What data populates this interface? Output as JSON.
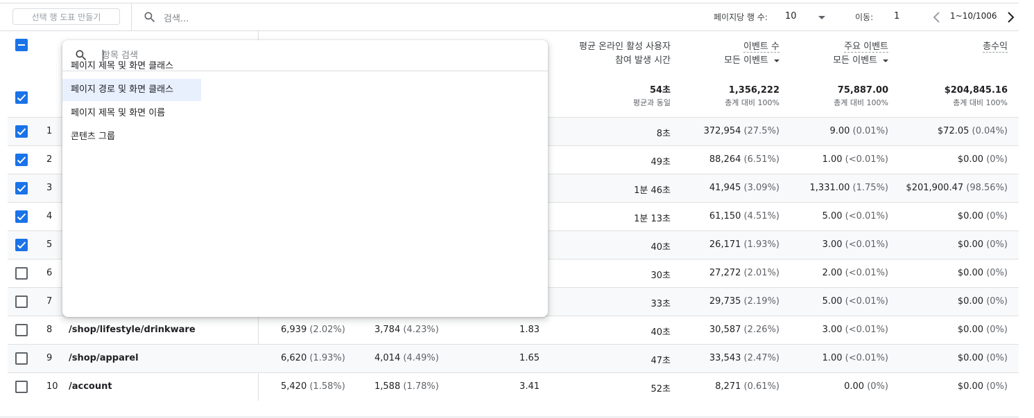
{
  "toolbar": {
    "chart_button": "선택 행 도표 만들기",
    "search_placeholder": "검색...",
    "rows_per_page_label": "페이지당 행 수:",
    "rows_per_page_value": "10",
    "goto_label": "이동:",
    "goto_value": "1",
    "range": "1~10/1006"
  },
  "header": {
    "metric1_line1": "평균 온라인 활성 사용자",
    "metric1_line2": "참여 발생 시간",
    "events": {
      "label": "이벤트 수",
      "filter": "모든 이벤트"
    },
    "key_events": {
      "label": "주요 이벤트",
      "filter": "모든 이벤트"
    },
    "revenue": {
      "label": "총수익"
    }
  },
  "totals": {
    "engagement": {
      "value": "54초",
      "sub": "평균과 동일"
    },
    "events": {
      "value": "1,356,222",
      "sub": "총계 대비 100%"
    },
    "key_events": {
      "value": "75,887.00",
      "sub": "총계 대비 100%"
    },
    "revenue": {
      "value": "$204,845.16",
      "sub": "총계 대비 100%"
    }
  },
  "rows": [
    {
      "idx": "1",
      "checked": true,
      "path": "",
      "views": "",
      "views_pct": "",
      "users": "",
      "users_pct": "",
      "vpu": "",
      "time": "8초",
      "events": "372,954",
      "events_pct": "(27.5%)",
      "key": "9.00",
      "key_pct": "(0.01%)",
      "rev": "$72.05",
      "rev_pct": "(0.04%)"
    },
    {
      "idx": "2",
      "checked": true,
      "path": "",
      "views": "",
      "views_pct": "",
      "users": "",
      "users_pct": "",
      "vpu": "",
      "time": "49초",
      "events": "88,264",
      "events_pct": "(6.51%)",
      "key": "1.00",
      "key_pct": "(<0.01%)",
      "rev": "$0.00",
      "rev_pct": "(0%)"
    },
    {
      "idx": "3",
      "checked": true,
      "path": "",
      "views": "",
      "views_pct": "",
      "users": "",
      "users_pct": "",
      "vpu": "",
      "time": "1분 46초",
      "events": "41,945",
      "events_pct": "(3.09%)",
      "key": "1,331.00",
      "key_pct": "(1.75%)",
      "rev": "$201,900.47",
      "rev_pct": "(98.56%)"
    },
    {
      "idx": "4",
      "checked": true,
      "path": "",
      "views": "",
      "views_pct": "",
      "users": "",
      "users_pct": "",
      "vpu": "",
      "time": "1분 13초",
      "events": "61,150",
      "events_pct": "(4.51%)",
      "key": "5.00",
      "key_pct": "(<0.01%)",
      "rev": "$0.00",
      "rev_pct": "(0%)"
    },
    {
      "idx": "5",
      "checked": true,
      "path": "",
      "views": "",
      "views_pct": "",
      "users": "",
      "users_pct": "",
      "vpu": "",
      "time": "40초",
      "events": "26,171",
      "events_pct": "(1.93%)",
      "key": "3.00",
      "key_pct": "(<0.01%)",
      "rev": "$0.00",
      "rev_pct": "(0%)"
    },
    {
      "idx": "6",
      "checked": false,
      "path": "",
      "views": "",
      "views_pct": "",
      "users": "",
      "users_pct": "",
      "vpu": "",
      "time": "30초",
      "events": "27,272",
      "events_pct": "(2.01%)",
      "key": "2.00",
      "key_pct": "(<0.01%)",
      "rev": "$0.00",
      "rev_pct": "(0%)"
    },
    {
      "idx": "7",
      "checked": false,
      "path": "",
      "views": "",
      "views_pct": "",
      "users": "",
      "users_pct": "",
      "vpu": "",
      "time": "33초",
      "events": "29,735",
      "events_pct": "(2.19%)",
      "key": "5.00",
      "key_pct": "(<0.01%)",
      "rev": "$0.00",
      "rev_pct": "(0%)"
    },
    {
      "idx": "8",
      "checked": false,
      "path": "/shop/lifestyle/drinkware",
      "views": "6,939",
      "views_pct": "(2.02%)",
      "users": "3,784",
      "users_pct": "(4.23%)",
      "vpu": "1.83",
      "time": "40초",
      "events": "30,587",
      "events_pct": "(2.26%)",
      "key": "3.00",
      "key_pct": "(<0.01%)",
      "rev": "$0.00",
      "rev_pct": "(0%)"
    },
    {
      "idx": "9",
      "checked": false,
      "path": "/shop/apparel",
      "views": "6,620",
      "views_pct": "(1.93%)",
      "users": "4,014",
      "users_pct": "(4.49%)",
      "vpu": "1.65",
      "time": "47초",
      "events": "33,543",
      "events_pct": "(2.47%)",
      "key": "1.00",
      "key_pct": "(<0.01%)",
      "rev": "$0.00",
      "rev_pct": "(0%)"
    },
    {
      "idx": "10",
      "checked": false,
      "path": "/account",
      "views": "5,420",
      "views_pct": "(1.58%)",
      "users": "1,588",
      "users_pct": "(1.78%)",
      "vpu": "3.41",
      "time": "52초",
      "events": "8,271",
      "events_pct": "(0.61%)",
      "key": "0.00",
      "key_pct": "(0%)",
      "rev": "$0.00",
      "rev_pct": "(0%)"
    }
  ],
  "popup": {
    "search_placeholder": "항목 검색",
    "options": [
      {
        "label": "페이지 제목 및 화면 클래스",
        "selected": false
      },
      {
        "label": "페이지 경로 및 화면 클래스",
        "selected": true
      },
      {
        "label": "페이지 제목 및 화면 이름",
        "selected": false
      },
      {
        "label": "콘텐츠 그룹",
        "selected": false
      }
    ]
  },
  "colors": {
    "accent": "#1a73e8",
    "selected_bg": "#e8f0fe",
    "row_shade": "#f8f9fa"
  },
  "icons": {
    "search": "search-icon",
    "prev": "chevron-left-icon",
    "next": "chevron-right-icon",
    "dropdown": "caret-down-icon",
    "check": "check-icon",
    "indeterminate": "minus-icon"
  }
}
